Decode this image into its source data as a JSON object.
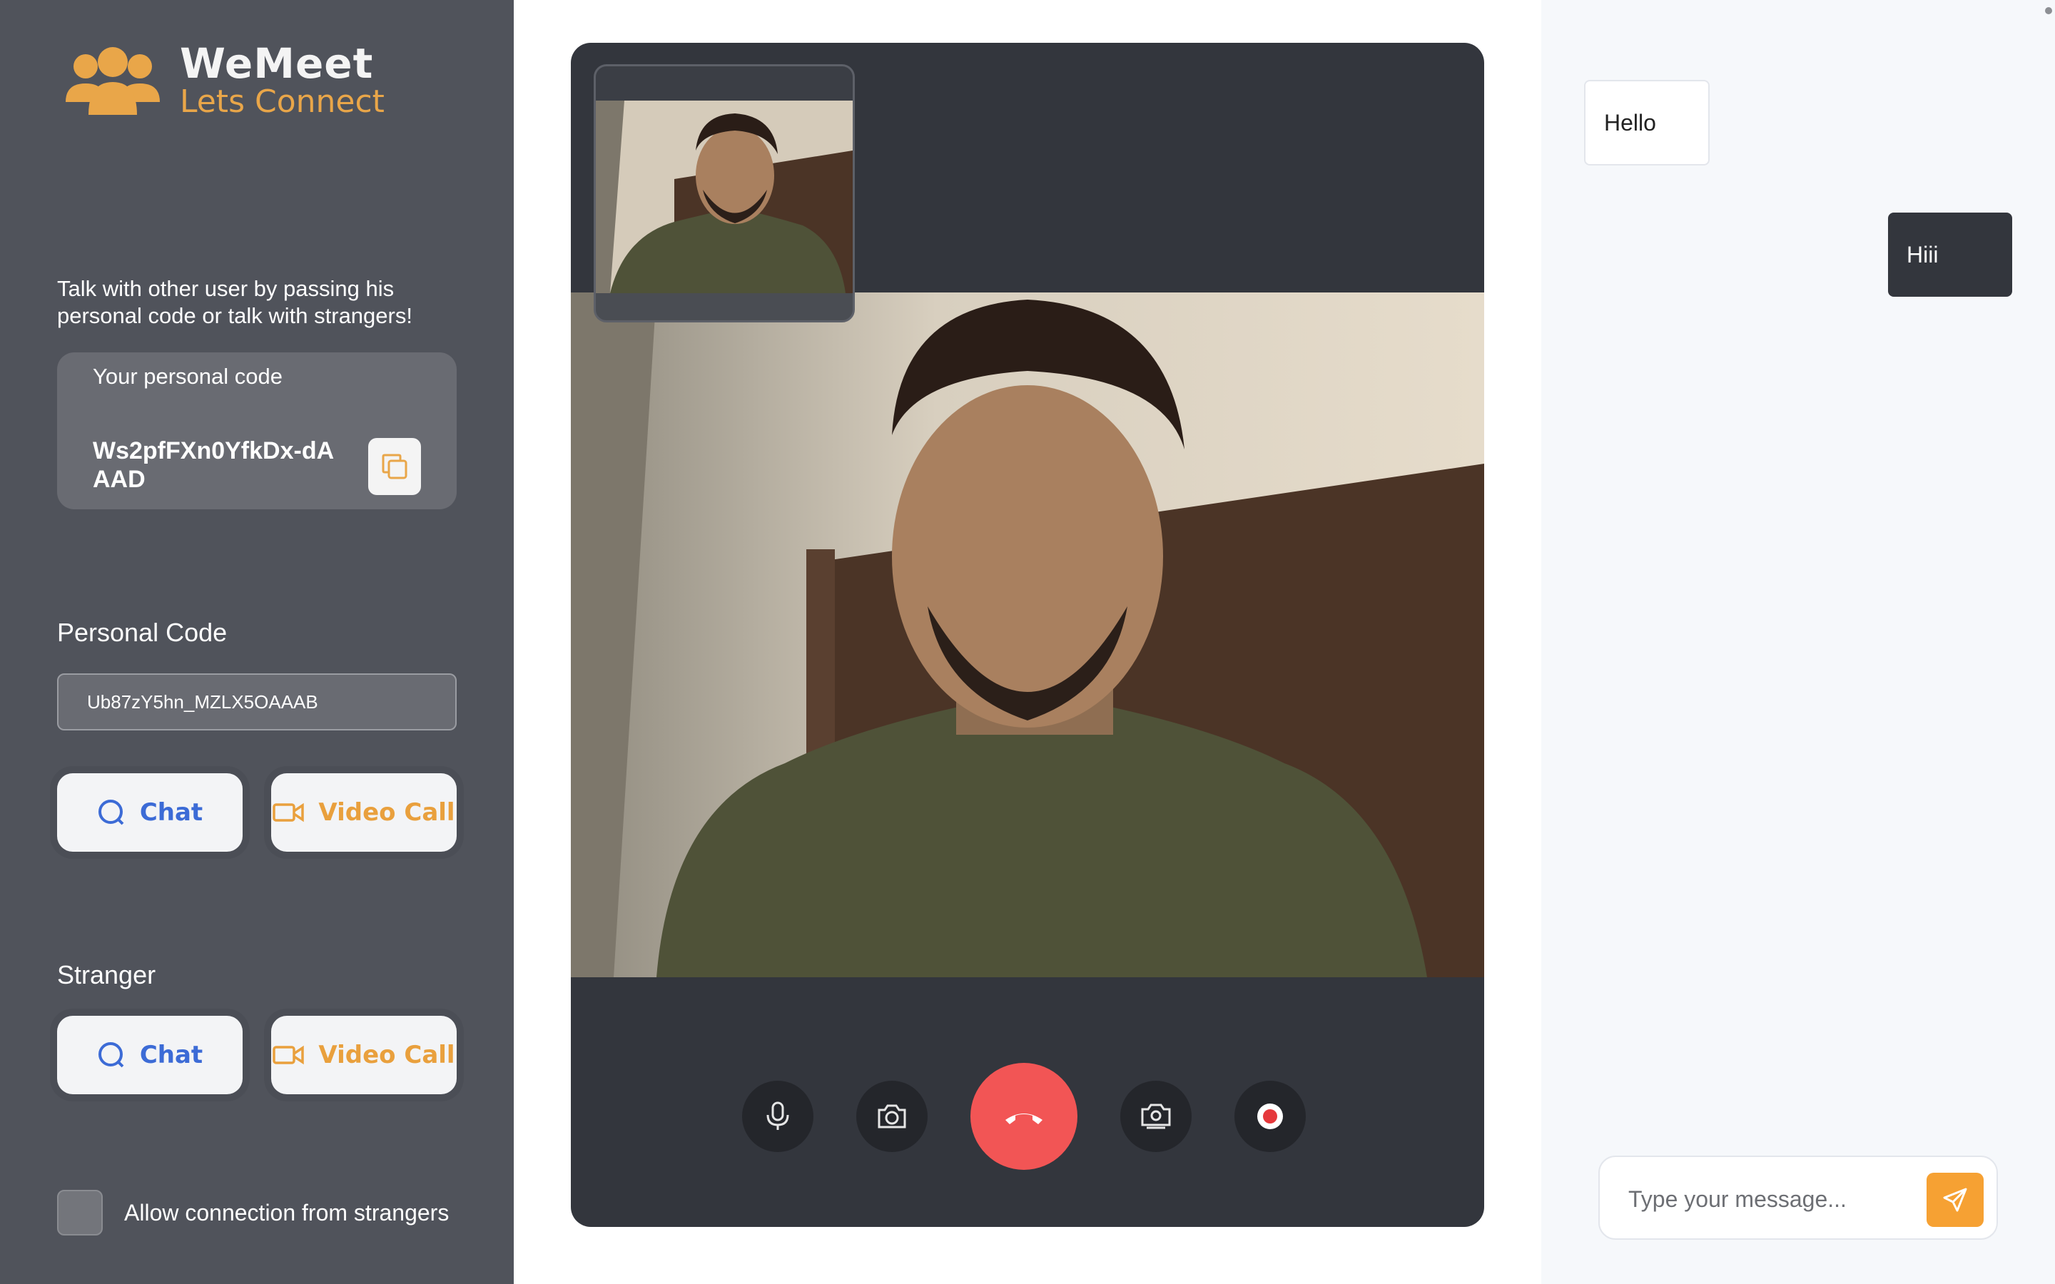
{
  "brand": {
    "name": "WeMeet",
    "tagline": "Lets Connect",
    "accent": "#e9a649"
  },
  "sidebar": {
    "intro": "Talk with other user by passing his personal code or talk with strangers!",
    "personal_code_card": {
      "label": "Your personal code",
      "value": "Ws2pfFXn0YfkDx-dAAAD",
      "copy_icon": "copy-icon"
    },
    "personal_section": {
      "title": "Personal Code",
      "input_value": "Ub87zY5hn_MZLX5OAAAB",
      "chat_label": "Chat",
      "video_label": "Video Call"
    },
    "stranger_section": {
      "title": "Stranger",
      "chat_label": "Chat",
      "video_label": "Video Call"
    },
    "allow_strangers": {
      "label": "Allow connection from strangers",
      "checked": false
    }
  },
  "call_controls": {
    "items": [
      "microphone-icon",
      "camera-icon",
      "hang-up-icon",
      "switch-camera-icon",
      "record-icon"
    ],
    "hangup_color": "#f25555"
  },
  "chat": {
    "messages": [
      {
        "direction": "incoming",
        "text": "Hello"
      },
      {
        "direction": "outgoing",
        "text": "Hiii"
      }
    ],
    "input_placeholder": "Type your message...",
    "send_icon": "send-icon",
    "send_color": "#f6a133"
  }
}
